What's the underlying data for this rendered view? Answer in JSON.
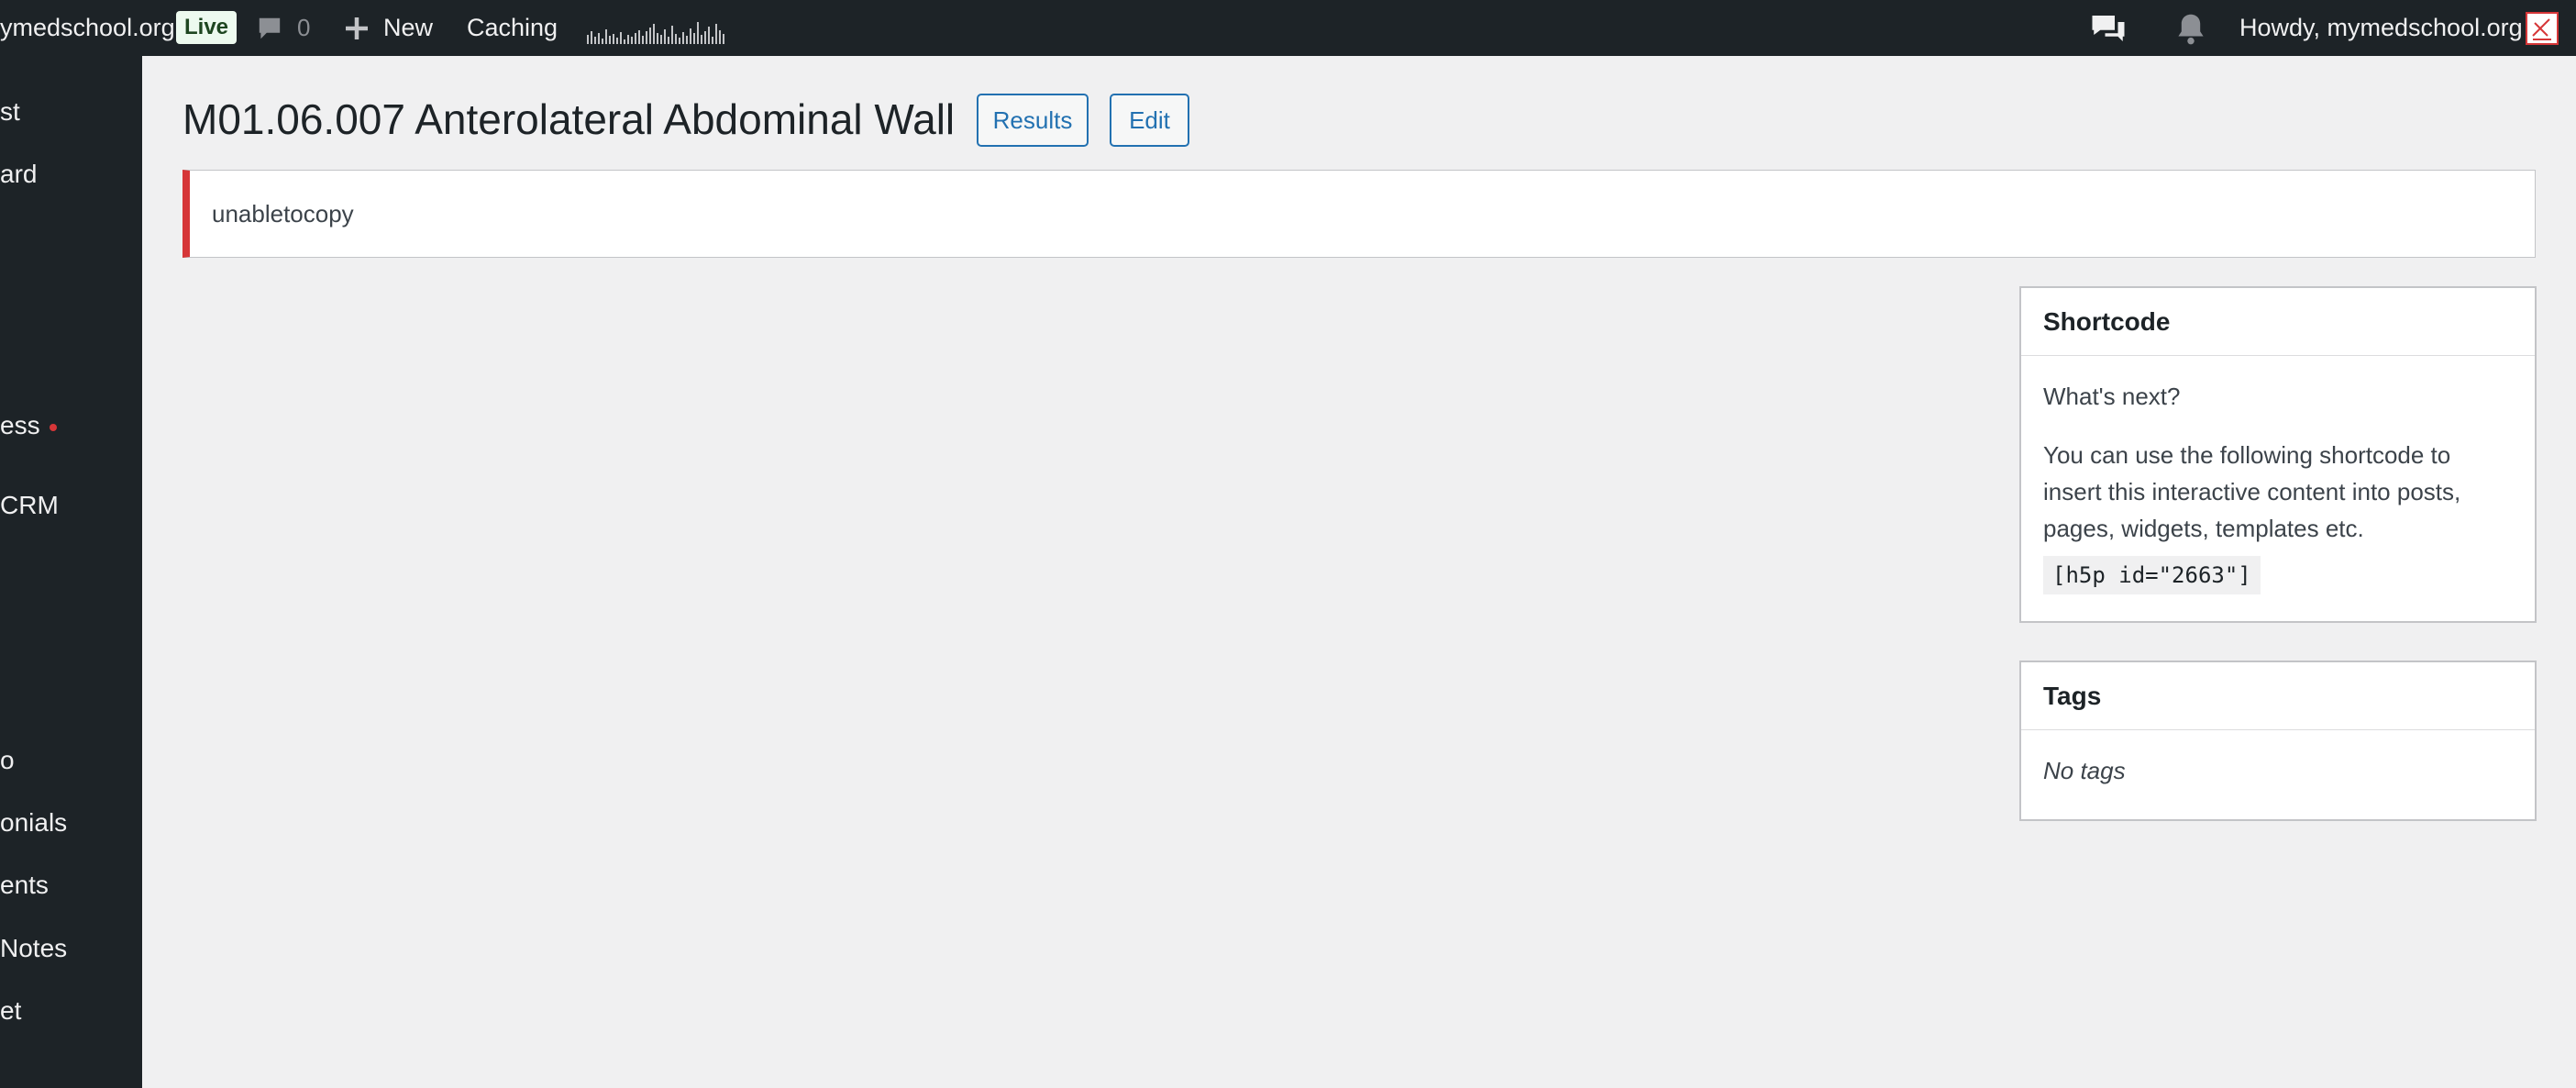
{
  "adminbar": {
    "site_name": "ymedschool.org",
    "live_label": "Live",
    "comments_count": "0",
    "new_label": "New",
    "caching_label": "Caching",
    "greeting": "Howdy, mymedschool.org"
  },
  "sidebar": {
    "items": [
      {
        "label": "st"
      },
      {
        "label": "ard"
      },
      {
        "label": "ess"
      },
      {
        "label": " CRM"
      },
      {
        "label": "o"
      },
      {
        "label": "onials"
      },
      {
        "label": "ents"
      },
      {
        "label": "Notes"
      },
      {
        "label": "et"
      }
    ]
  },
  "main": {
    "title": "M01.06.007 Anterolateral Abdominal Wall",
    "results_label": "Results",
    "edit_label": "Edit",
    "notice_text": "unabletocopy"
  },
  "shortcode_box": {
    "title": "Shortcode",
    "whats_next": "What's next?",
    "description": "You can use the following shortcode to insert this interactive content into posts, pages, widgets, templates etc.",
    "code": "[h5p id=\"2663\"]"
  },
  "tags_box": {
    "title": "Tags",
    "empty_text": "No tags"
  },
  "colors": {
    "adminbar_bg": "#1d2327",
    "accent": "#2271b1",
    "error": "#d63638",
    "page_bg": "#f0f0f1"
  }
}
